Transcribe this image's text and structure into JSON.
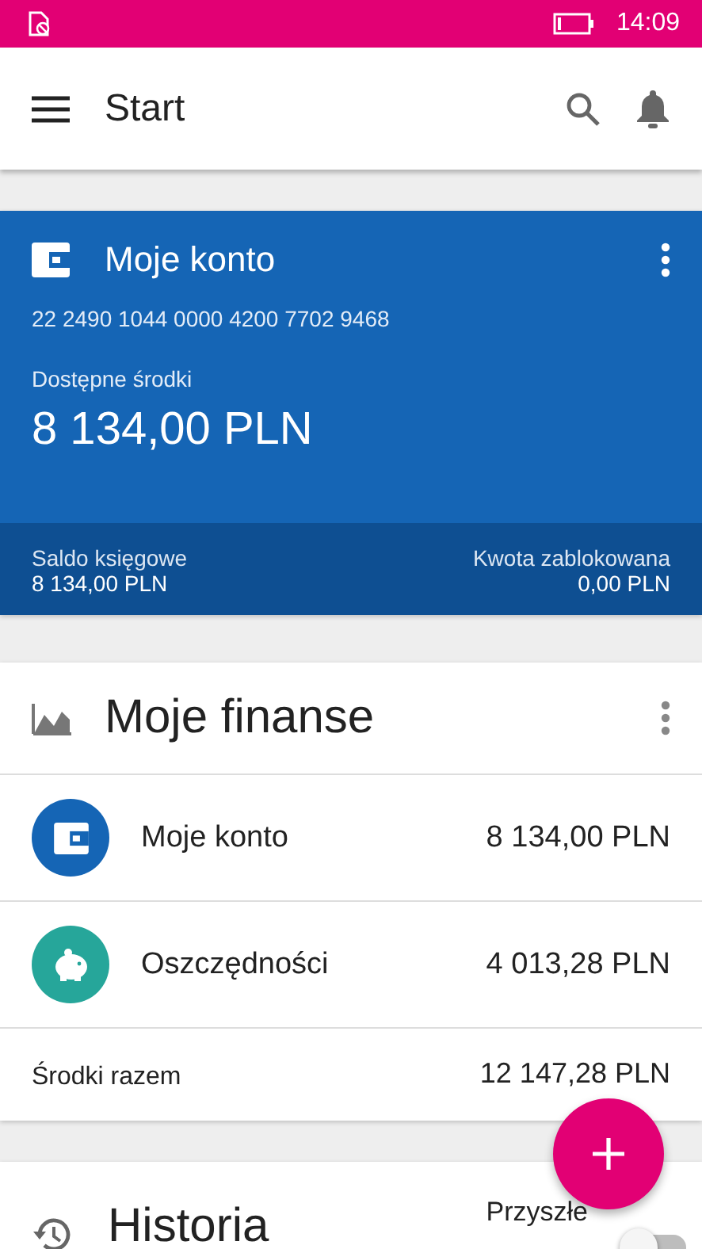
{
  "status_bar": {
    "time": "14:09"
  },
  "app_bar": {
    "title": "Start"
  },
  "account_card": {
    "title": "Moje konto",
    "number": "22 2490 1044 0000 4200 7702 9468",
    "available_label": "Dostępne środki",
    "available": "8 134,00 PLN",
    "book_label": "Saldo księgowe",
    "book": "8 134,00 PLN",
    "blocked_label": "Kwota zablokowana",
    "blocked": "0,00 PLN"
  },
  "finances": {
    "title": "Moje finanse",
    "items": [
      {
        "kind": "wallet",
        "name": "Moje konto",
        "amount": "8 134,00 PLN",
        "color": "#1565b5"
      },
      {
        "kind": "piggy",
        "name": "Oszczędności",
        "amount": "4 013,28 PLN",
        "color": "#26a69a"
      }
    ],
    "total_label": "Środki razem",
    "total": "12 147,28 PLN"
  },
  "history": {
    "title": "Historia",
    "future_label": "Przyszłe",
    "future_on": false
  }
}
